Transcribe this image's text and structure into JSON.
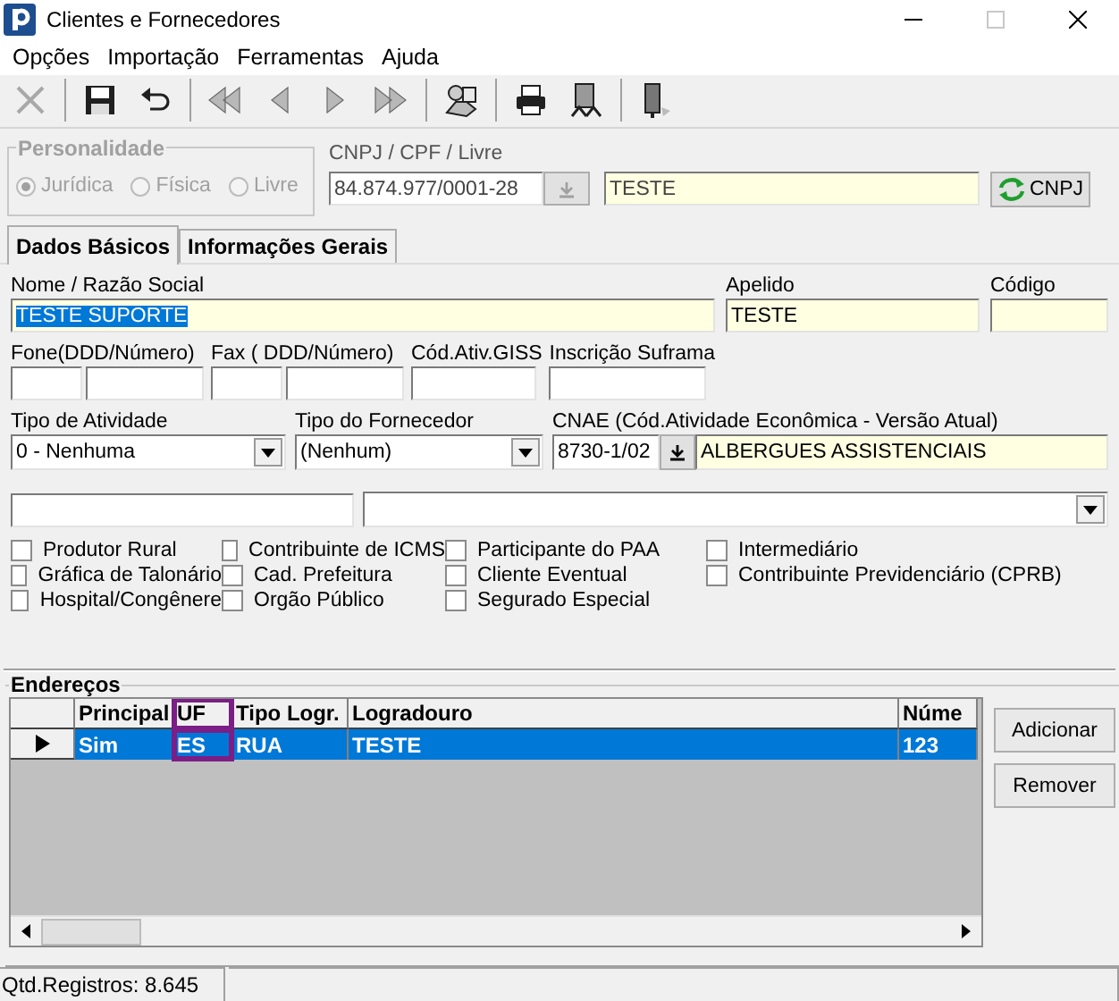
{
  "window": {
    "title": "Clientes e Fornecedores",
    "maximize_disabled": true
  },
  "menu": [
    "Opções",
    "Importação",
    "Ferramentas",
    "Ajuda"
  ],
  "toolbar": [
    {
      "kind": "cancel",
      "disabled": true
    },
    {
      "kind": "separator"
    },
    {
      "kind": "save",
      "disabled": false
    },
    {
      "kind": "undo",
      "disabled": false
    },
    {
      "kind": "separator"
    },
    {
      "kind": "first",
      "disabled": true
    },
    {
      "kind": "prev",
      "disabled": true
    },
    {
      "kind": "next",
      "disabled": true
    },
    {
      "kind": "last",
      "disabled": true
    },
    {
      "kind": "separator"
    },
    {
      "kind": "people",
      "disabled": false
    },
    {
      "kind": "separator"
    },
    {
      "kind": "print",
      "disabled": false
    },
    {
      "kind": "report",
      "disabled": false
    },
    {
      "kind": "separator"
    },
    {
      "kind": "exit",
      "disabled": false
    }
  ],
  "personalidade": {
    "title": "Personalidade",
    "disabled": true,
    "options": [
      {
        "label": "Jurídica",
        "selected": true
      },
      {
        "label": "Física",
        "selected": false
      },
      {
        "label": "Livre",
        "selected": false
      }
    ]
  },
  "document": {
    "label": "CNPJ / CPF / Livre",
    "value": "84.874.977/0001-28",
    "name_value": "TESTE",
    "button": "CNPJ"
  },
  "tabs": [
    {
      "label": "Dados Básicos",
      "selected": true
    },
    {
      "label": "Informações Gerais",
      "selected": false
    }
  ],
  "nome": {
    "label": "Nome / Razão Social",
    "value": "TESTE SUPORTE",
    "value_selected": true
  },
  "apelido": {
    "label": "Apelido",
    "value": "TESTE"
  },
  "codigo": {
    "label": "Código"
  },
  "fone": {
    "label": "Fone(DDD/Número)"
  },
  "fax": {
    "label": "Fax ( DDD/Número)"
  },
  "giss": {
    "label": "Cód.Ativ.GISS"
  },
  "suframa": {
    "label": "Inscrição Suframa"
  },
  "tipo_atividade": {
    "label": "Tipo de Atividade",
    "value": "0 - Nenhuma"
  },
  "tipo_fornecedor": {
    "label": "Tipo do Fornecedor",
    "value": "(Nenhum)"
  },
  "cnae": {
    "label": "CNAE (Cód.Atividade Econômica - Versão Atual)",
    "code": "8730-1/02",
    "description": "ALBERGUES ASSISTENCIAIS"
  },
  "checkboxes": [
    {
      "label": "Produtor Rural",
      "checked": false
    },
    {
      "label": "Contribuinte de ICMS",
      "checked": false
    },
    {
      "label": "Participante do PAA",
      "checked": false
    },
    {
      "label": "Intermediário",
      "checked": false
    },
    {
      "label": "Gráfica de Talonário",
      "checked": false
    },
    {
      "label": "Cad. Prefeitura",
      "checked": false
    },
    {
      "label": "Cliente Eventual",
      "checked": false
    },
    {
      "label": "Contribuinte Previdenciário (CPRB)",
      "checked": false
    },
    {
      "label": "Hospital/Congênere",
      "checked": false
    },
    {
      "label": "Orgão Público",
      "checked": false
    },
    {
      "label": "Segurado Especial",
      "checked": false
    }
  ],
  "enderecos": {
    "title": "Endereços",
    "columns": [
      {
        "label": "Principal",
        "highlighted": false
      },
      {
        "label": "UF",
        "highlighted": true
      },
      {
        "label": "Tipo Logr.",
        "highlighted": false
      },
      {
        "label": "Logradouro",
        "highlighted": false
      },
      {
        "label": "Núme",
        "highlighted": false
      }
    ],
    "rows": [
      {
        "selected": true,
        "cells": [
          "Sim",
          "ES",
          "RUA",
          "TESTE",
          "123"
        ]
      }
    ],
    "buttons": [
      "Adicionar",
      "Remover"
    ]
  },
  "status_bar": {
    "records": "Qtd.Registros: 8.645"
  }
}
